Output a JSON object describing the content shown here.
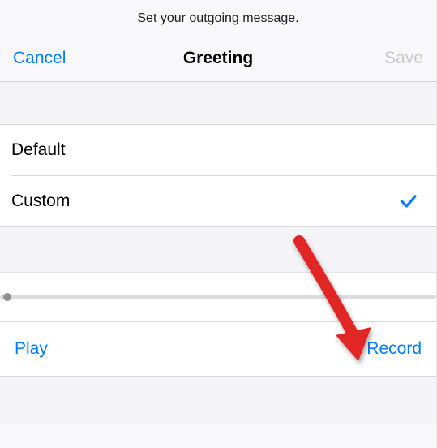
{
  "instruction": "Set your outgoing message.",
  "nav": {
    "cancel": "Cancel",
    "title": "Greeting",
    "save": "Save"
  },
  "options": {
    "default_label": "Default",
    "custom_label": "Custom",
    "selected": "custom"
  },
  "controls": {
    "play": "Play",
    "record": "Record"
  },
  "colors": {
    "accent": "#007aff",
    "disabled": "#c7c7cc"
  }
}
